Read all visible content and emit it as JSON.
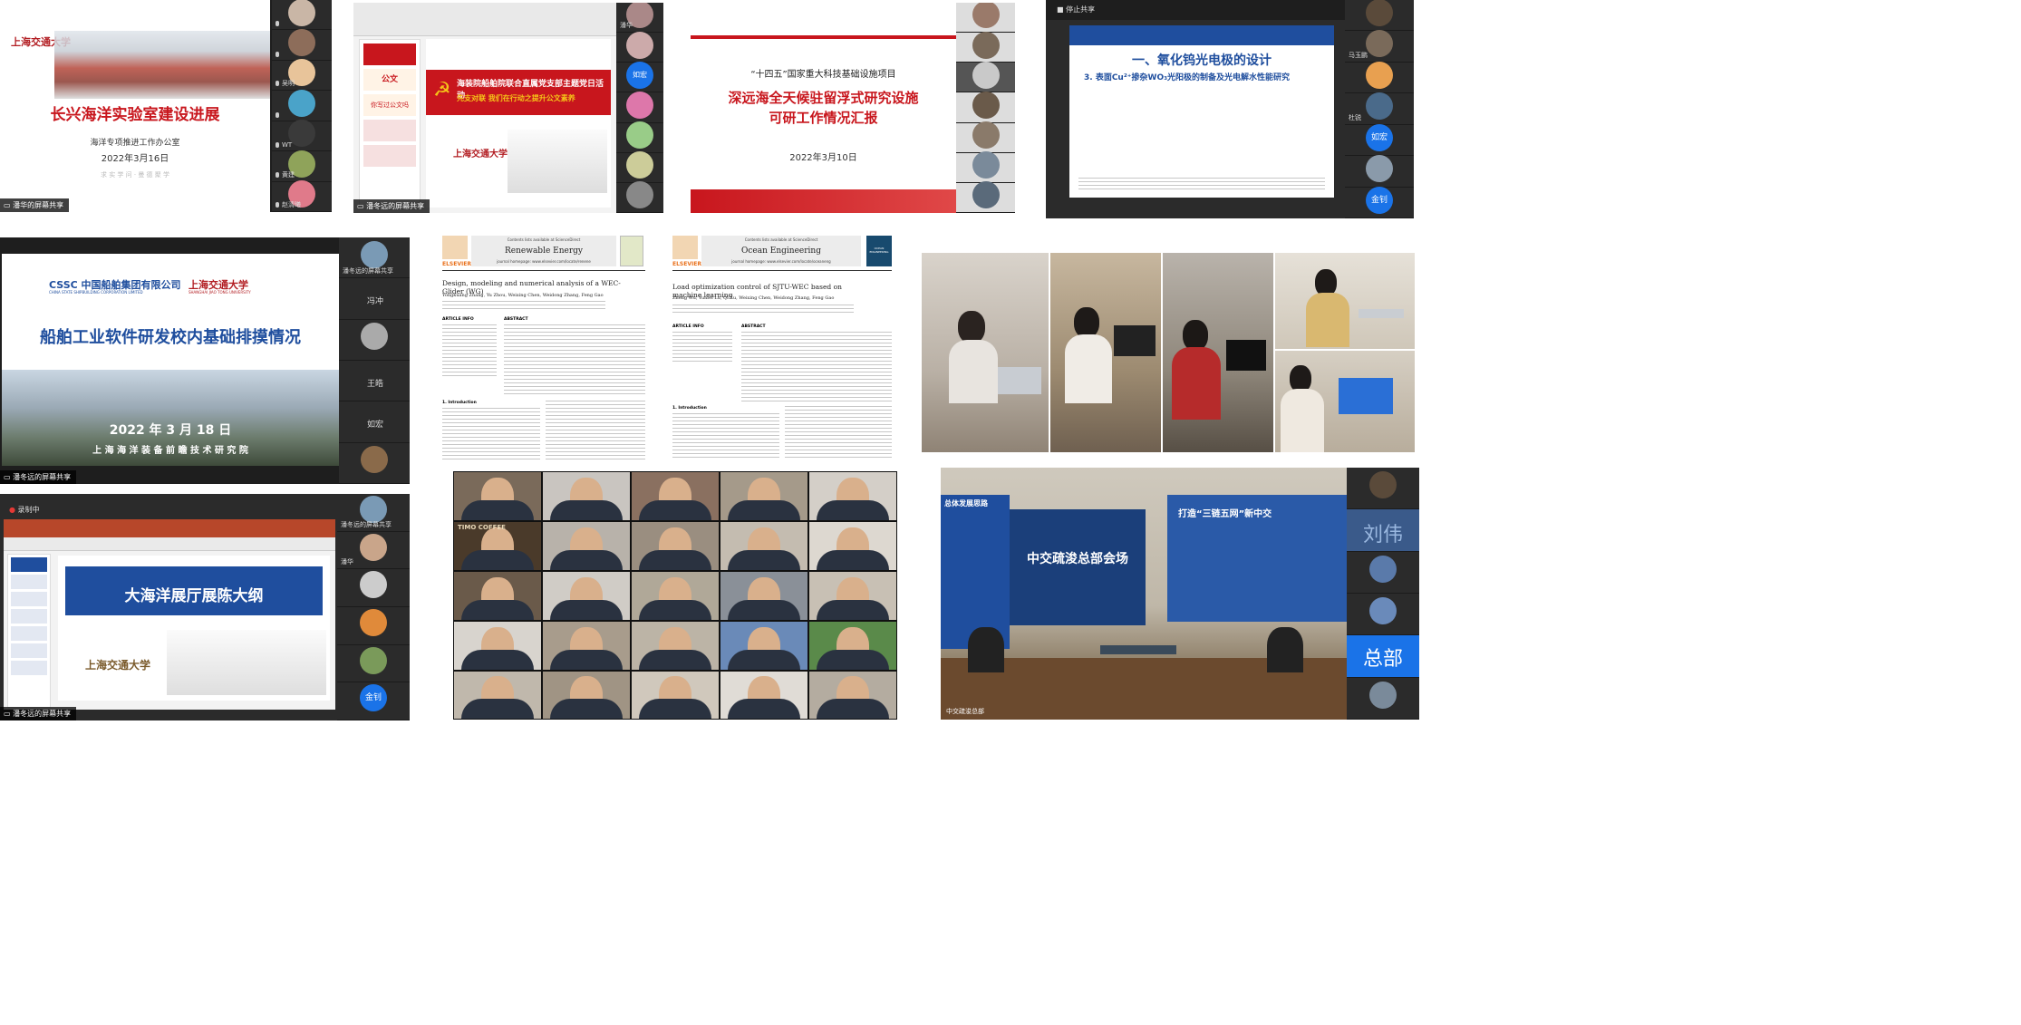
{
  "tile1": {
    "title": "长兴海洋实验室建设进展",
    "subtitle": "海洋专项推进工作办公室",
    "date": "2022年3月16日",
    "logo": "上海交通大学",
    "footer": "求 实 学 问 · 曼 德 聚 学",
    "share_label": "潘华的屏幕共享",
    "participants": [
      "",
      "",
      "吴明",
      "",
      "WT",
      "黄建",
      "赵清曦"
    ]
  },
  "tile2": {
    "banner_title": "海装院船舶院联合直属党支部主题党日活动",
    "banner_subtitle": "先支对联  我们在行动之提升公文素养",
    "logo": "上海交通大学",
    "share_label": "潘冬远的屏幕共享",
    "side_panels": [
      "公文",
      "你写过公文吗"
    ],
    "participants": [
      "潘华",
      "",
      "如宏",
      "",
      "",
      "",
      ""
    ]
  },
  "tile3": {
    "heading": "“十四五”国家重大科技基础设施项目",
    "title_line1": "深远海全天候驻留浮式研究设施",
    "title_line2": "可研工作情况汇报",
    "date": "2022年3月10日",
    "participants": [
      "",
      "",
      "",
      "",
      "",
      "",
      ""
    ]
  },
  "tile4": {
    "toolbar": "停止共享",
    "title1": "一、氧化钨光电极的设计",
    "title2": "3. 表面Cu²⁺掺杂WO₃光阳极的制备及光电解水性能研究",
    "badge1": "如宏",
    "badge2": "金钊",
    "participants": [
      "",
      "马玉鹏",
      "",
      "杜锐",
      "",
      "",
      ""
    ]
  },
  "tile5": {
    "logo_left": "CSSC 中国船舶集团有限公司",
    "logo_left_sub": "CHINA STATE SHIPBUILDING CORPORATION LIMITED",
    "logo_right": "上海交通大学",
    "logo_right_sub": "SHANGHAI JIAO TONG UNIVERSITY",
    "title": "船舶工业软件研发校内基础排摸情况",
    "date": "2022 年 3 月 18 日",
    "org": "上 海 海 洋 装 备 前 瞻 技 术 研 究 院",
    "share_label": "潘冬远的屏幕共享",
    "participants": [
      "潘冬远的屏幕共享",
      "冯冲",
      "",
      "王皓",
      "如宏",
      ""
    ]
  },
  "paper1": {
    "journal": "Renewable Energy",
    "title": "Design, modeling and numerical analysis of a WEC-Glider (WG)",
    "authors": "Yongkuang Zhang, Yu Zhou, Weixing Chen, Weidong Zhang, Feng Gao",
    "article_info": "ARTICLE INFO",
    "abstract": "ABSTRACT",
    "intro": "1. Introduction",
    "publisher": "ELSEVIER",
    "contents": "Contents lists available at ScienceDirect",
    "homepage": "journal homepage: www.elsevier.com/locate/renene"
  },
  "paper2": {
    "journal": "Ocean Engineering",
    "title": "Load optimization control of SJTU-WEC based on machine learning",
    "authors": "Zheng Wu, Yunfei Lu, Qi Xu, Weixing Chen, Weidong Zhang, Feng Gao",
    "article_info": "ARTICLE INFO",
    "abstract": "ABSTRACT",
    "intro": "1. Introduction",
    "publisher": "ELSEVIER",
    "contents": "Contents lists available at ScienceDirect",
    "homepage": "journal homepage: www.elsevier.com/locate/oceaneng",
    "cover": "OCEAN ENGINEERING"
  },
  "tile7": {
    "rec_label": "录制中",
    "title": "大海洋展厅展陈大纲",
    "logo": "上海交通大学",
    "share_label": "潘冬远的屏幕共享",
    "badge": "金钊",
    "participants": [
      "潘冬远的屏幕共享",
      "潘华",
      "",
      "",
      "",
      "",
      ""
    ]
  },
  "tile8": {
    "poster": "TIMO COFFEE"
  },
  "tile9": {
    "wall_title": "中交疏浚总部会场",
    "left_banner": "总体发展思路",
    "right_banner": "打造“三链五网”新中交",
    "nameplate": "刘伟",
    "badge": "总部",
    "caption": "中交疏浚总部"
  },
  "colors": {
    "accent_red": "#c8161d",
    "accent_blue": "#1f4e9e",
    "zoom_blue": "#1a73e8",
    "zoom_dark": "#2b2b2b"
  }
}
